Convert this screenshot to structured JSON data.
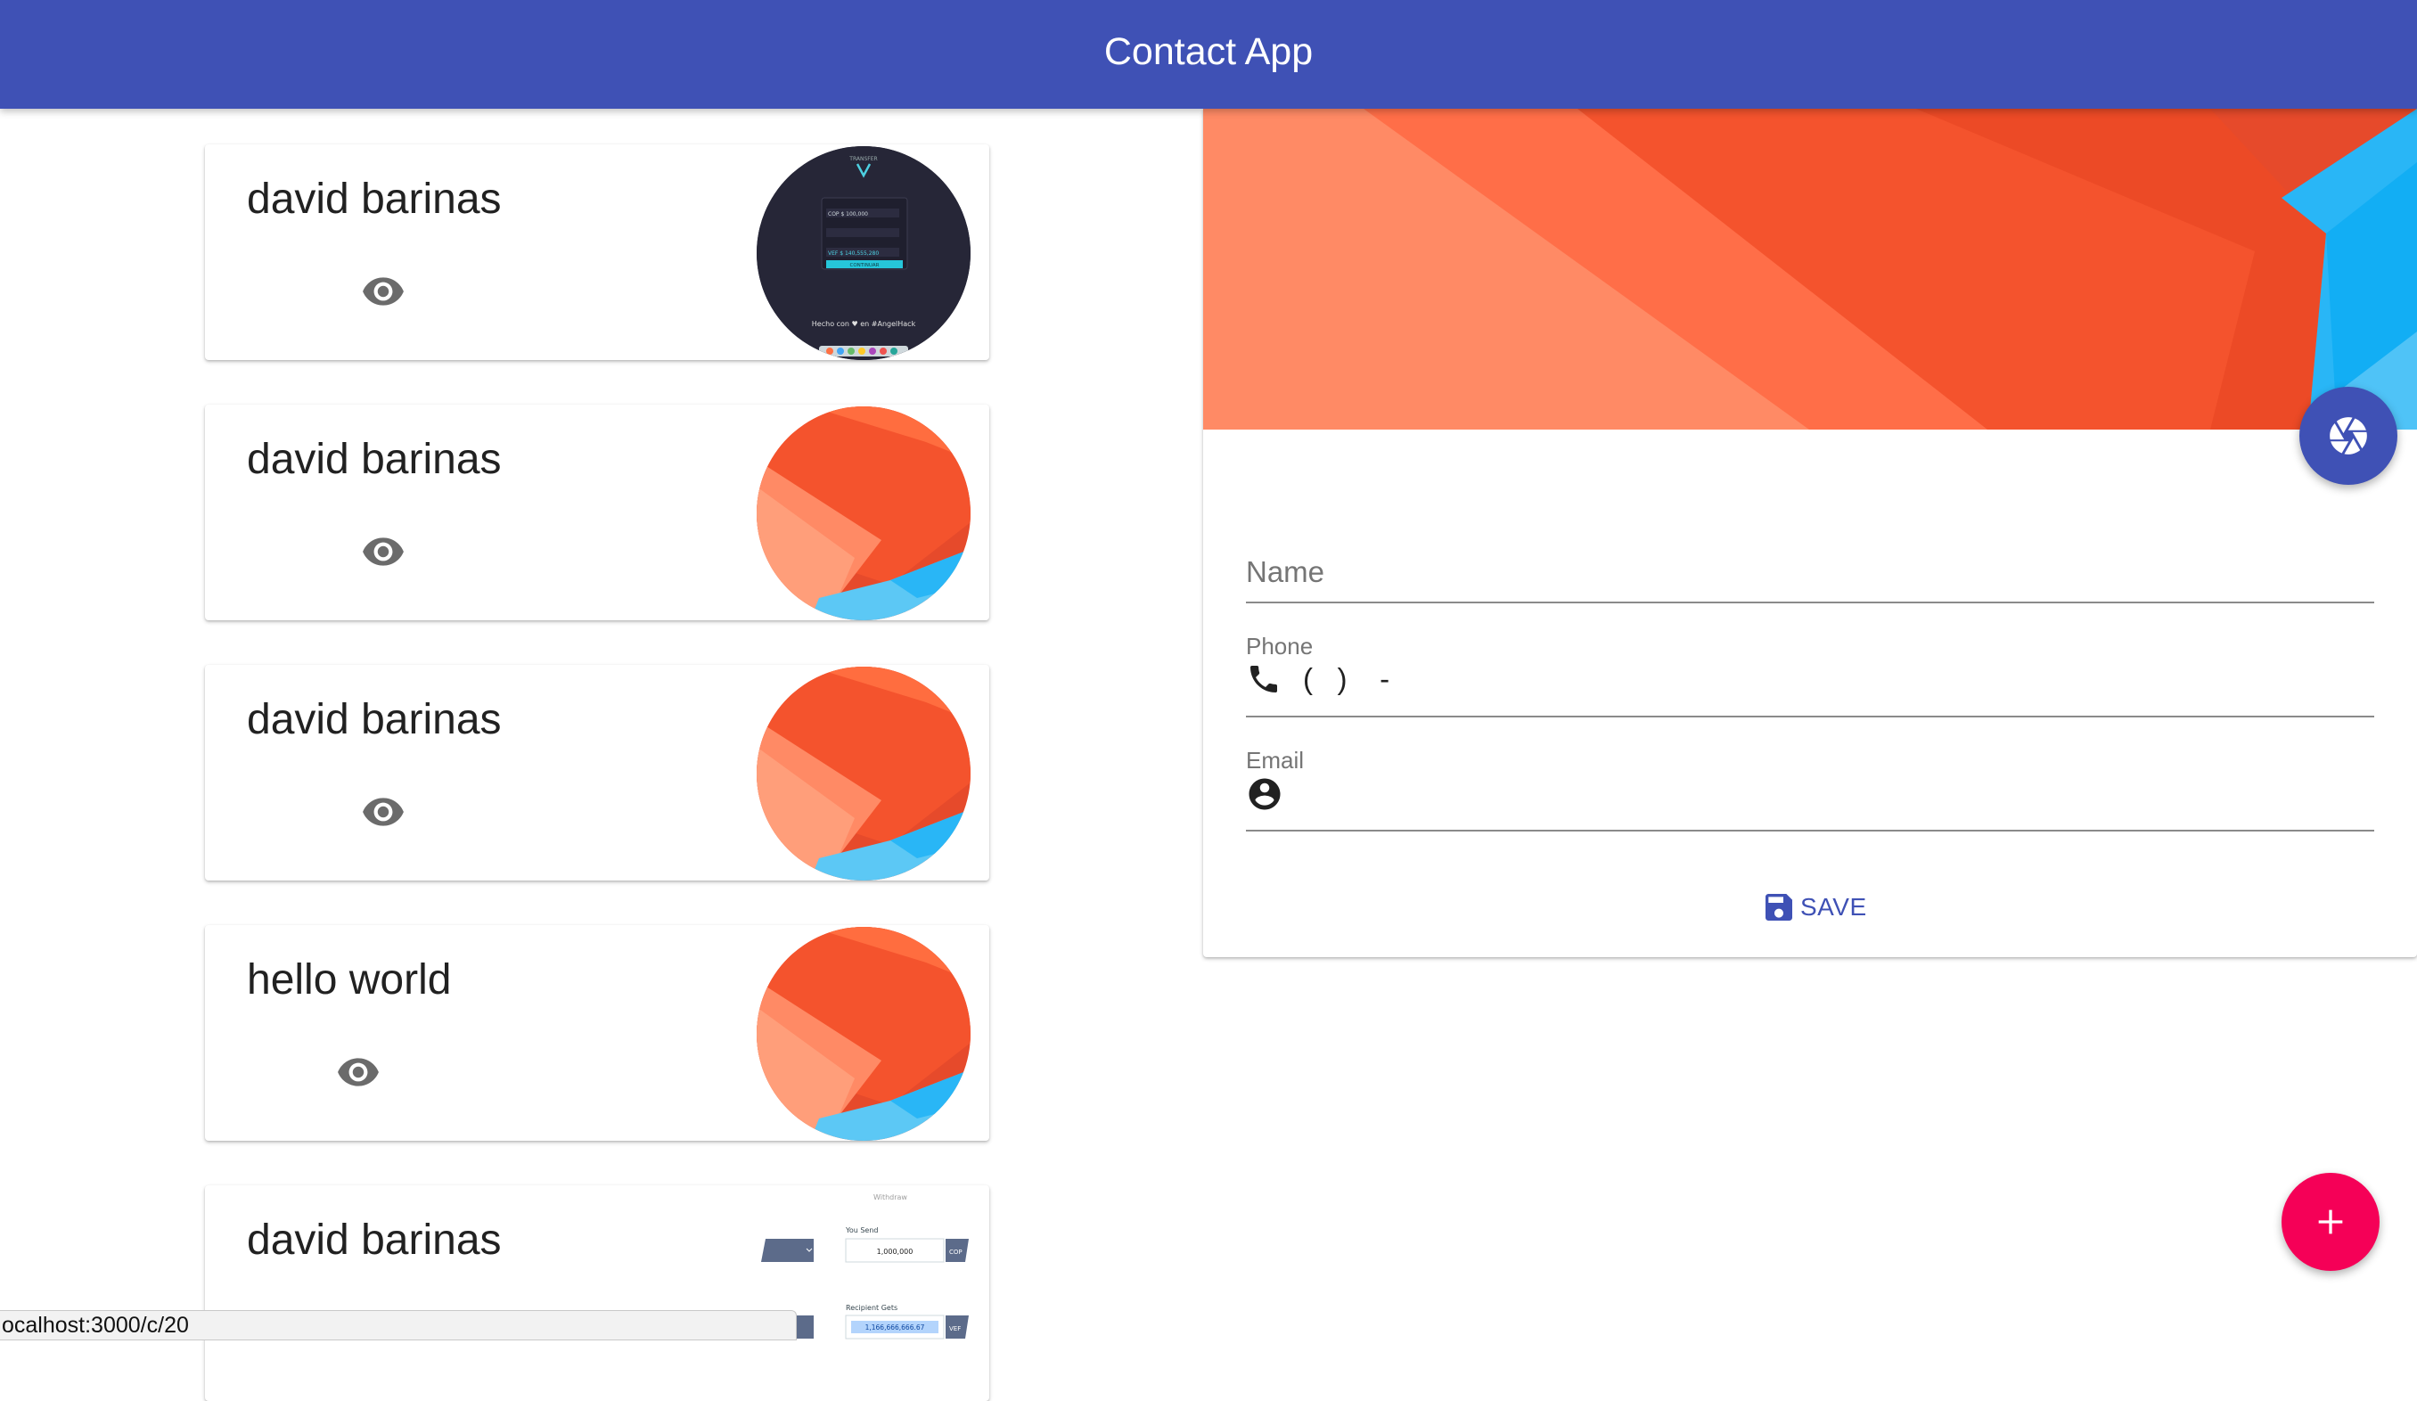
{
  "app_bar": {
    "title": "Contact App"
  },
  "contacts": [
    {
      "name": "david barinas",
      "avatar": "app-screenshot"
    },
    {
      "name": "david barinas",
      "avatar": "orange-material"
    },
    {
      "name": "david barinas",
      "avatar": "orange-material"
    },
    {
      "name": "hello world",
      "avatar": "orange-material"
    },
    {
      "name": "david barinas",
      "avatar": "withdraw-screenshot"
    }
  ],
  "avatar_text": {
    "app_title": "TRANSFER",
    "you_send_row": "COP $ 100,000",
    "recipient_row": "VEF $ 140,555,280",
    "button": "CONTINUAR",
    "footer": "Hecho con ♥ en #AngelHack",
    "withdraw_title": "Withdraw",
    "you_send_label": "You Send",
    "you_send_value": "1,000,000",
    "recipient_label": "Recipient Gets",
    "recipient_value": "1,166,666,666.67",
    "cop": "COP",
    "vef": "VEF"
  },
  "form": {
    "name_label": "Name",
    "phone_label": "Phone",
    "phone_mask": "(   )    -",
    "email_label": "Email",
    "save_label": "SAVE"
  },
  "status_bar": {
    "url": "ocalhost:3000/c/20"
  },
  "icons": {
    "view": "eye-icon",
    "camera": "camera-shutter-icon",
    "phone": "phone-icon",
    "email": "account-circle-icon",
    "save": "floppy-save-icon",
    "add": "plus-icon"
  },
  "colors": {
    "primary": "#3f51b5",
    "accent": "#f50057",
    "orange": "#f4532d",
    "light_orange": "#ff8a65",
    "blue": "#29b6f6"
  }
}
